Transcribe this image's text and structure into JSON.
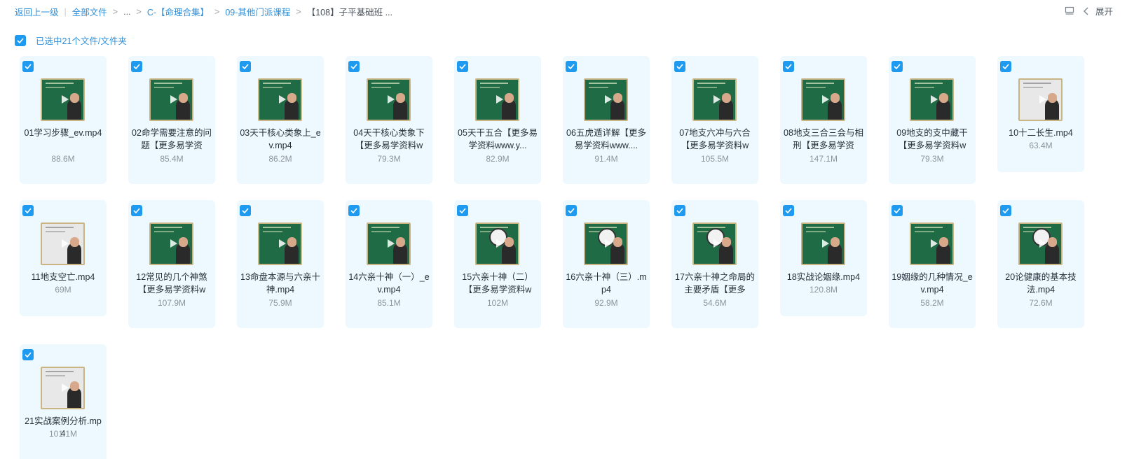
{
  "breadcrumb": {
    "back": "返回上一级",
    "all_files": "全部文件",
    "ellipsis": "...",
    "folder1": "C-【命理合集】",
    "folder2": "09-其他门派课程",
    "current": "【108】子平基础班 ..."
  },
  "toolbar": {
    "expand_label": "展开"
  },
  "selection": {
    "label": "已选中21个文件/文件夹"
  },
  "files": [
    {
      "name": "01学习步骤_ev.mp4",
      "size": "88.6M",
      "thumb": "board"
    },
    {
      "name": "02命学需要注意的问题【更多易学资",
      "size": "85.4M",
      "thumb": "board"
    },
    {
      "name": "03天干核心类象上_ev.mp4",
      "size": "86.2M",
      "thumb": "board"
    },
    {
      "name": "04天干核心类象下【更多易学资料w",
      "size": "79.3M",
      "thumb": "board"
    },
    {
      "name": "05天干五合【更多易学资料www.y...",
      "size": "82.9M",
      "thumb": "board"
    },
    {
      "name": "06五虎遁详解【更多易学资料www....",
      "size": "91.4M",
      "thumb": "board"
    },
    {
      "name": "07地支六冲与六合【更多易学资料w",
      "size": "105.5M",
      "thumb": "board"
    },
    {
      "name": "08地支三合三会与相刑【更多易学资",
      "size": "147.1M",
      "thumb": "board"
    },
    {
      "name": "09地支的支中藏干【更多易学资料w",
      "size": "79.3M",
      "thumb": "board"
    },
    {
      "name": "10十二长生.mp4",
      "size": "63.4M",
      "thumb": "sheet"
    },
    {
      "name": "11地支空亡.mp4",
      "size": "69M",
      "thumb": "sheet"
    },
    {
      "name": "12常见的几个神煞【更多易学资料w",
      "size": "107.9M",
      "thumb": "board"
    },
    {
      "name": "13命盘本源与六亲十神.mp4",
      "size": "75.9M",
      "thumb": "board"
    },
    {
      "name": "14六亲十神（一）_ev.mp4",
      "size": "85.1M",
      "thumb": "board"
    },
    {
      "name": "15六亲十神（二）【更多易学资料w",
      "size": "102M",
      "thumb": "wheel"
    },
    {
      "name": "16六亲十神（三）.mp4",
      "size": "92.9M",
      "thumb": "wheel"
    },
    {
      "name": "17六亲十神之命局的主要矛盾【更多",
      "size": "54.6M",
      "thumb": "wheel"
    },
    {
      "name": "18实战论姻缘.mp4",
      "size": "120.8M",
      "thumb": "board"
    },
    {
      "name": "19姻缘的几种情况_ev.mp4",
      "size": "58.2M",
      "thumb": "board"
    },
    {
      "name": "20论健康的基本技法.mp4",
      "size": "72.6M",
      "thumb": "wheel"
    },
    {
      "name": "21实战案例分析.mp4",
      "size": "101.1M",
      "thumb": "sheet"
    }
  ],
  "colors": {
    "accent": "#1e9bf0",
    "link": "#2f8fd8",
    "card_bg": "#eef8ff",
    "board": "#1f6b45"
  },
  "icons": {
    "check": "check-icon",
    "play": "play-icon",
    "list": "list-view-icon",
    "chevron": "chevron-left-icon"
  }
}
